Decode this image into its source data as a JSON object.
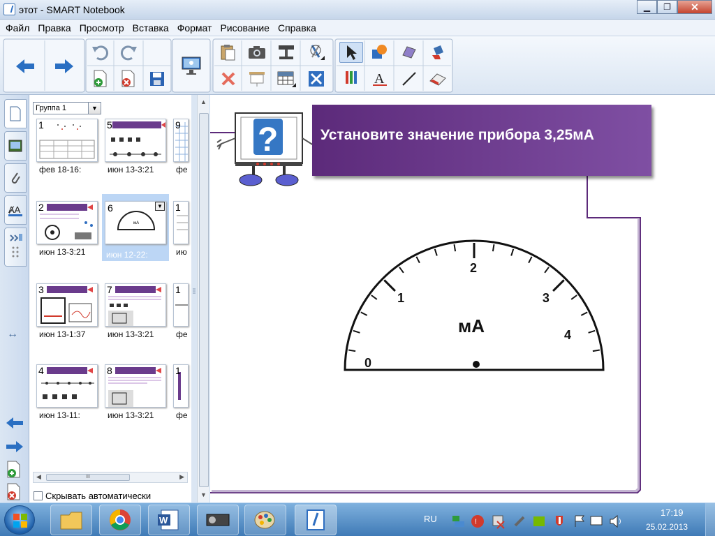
{
  "window": {
    "title": "этот - SMART Notebook"
  },
  "menu": [
    "Файл",
    "Правка",
    "Просмотр",
    "Вставка",
    "Формат",
    "Рисование",
    "Справка"
  ],
  "toolbar": {
    "buttons": [
      "back-arrow-icon",
      "forward-arrow-icon",
      "undo-icon",
      "redo-icon",
      "add-page-icon",
      "delete-page-icon",
      "save-icon",
      "screen-icon",
      "paste-icon",
      "delete-x-icon",
      "camera-icon",
      "screen-shade-icon",
      "document-camera-icon",
      "table-icon",
      "measurement-tools-icon",
      "full-screen-icon",
      "select-arrow-icon",
      "shapes-icon",
      "pens-icon",
      "creative-pens-icon",
      "eraser-icon",
      "text-icon",
      "line-icon",
      "fill-icon"
    ]
  },
  "colors": {
    "banner": "#5c2a7a",
    "banner2": "#7f4fa3",
    "accent_red": "#e04646",
    "blue": "#2f6ec0"
  },
  "sorter": {
    "group_label": "Группа 1",
    "thumbnails": [
      {
        "num": "1",
        "label": "фев  18-16:"
      },
      {
        "num": "5",
        "label": "июн  13-3:21"
      },
      {
        "num": "9",
        "label": "фе"
      },
      {
        "num": "2",
        "label": "июн  13-3:21"
      },
      {
        "num": "6",
        "label": "июн  12-22:"
      },
      {
        "num": "1",
        "label": "ию"
      },
      {
        "num": "3",
        "label": "июн  13-1:37"
      },
      {
        "num": "7",
        "label": "июн  13-3:21"
      },
      {
        "num": "1",
        "label": "фе"
      },
      {
        "num": "4",
        "label": "июн  13-11:"
      },
      {
        "num": "8",
        "label": "июн  13-3:21"
      },
      {
        "num": "1",
        "label": "фе"
      }
    ],
    "scroll_mark": "III",
    "autohide_label": "Скрывать автоматически"
  },
  "page": {
    "banner_text": "Установите значение прибора 3,25мА",
    "gauge": {
      "unit_label": "мА",
      "tick_labels": [
        "0",
        "1",
        "2",
        "3",
        "4"
      ],
      "needle_value": null
    }
  },
  "taskbar": {
    "lang": "RU",
    "time": "17:19",
    "date": "25.02.2013"
  }
}
